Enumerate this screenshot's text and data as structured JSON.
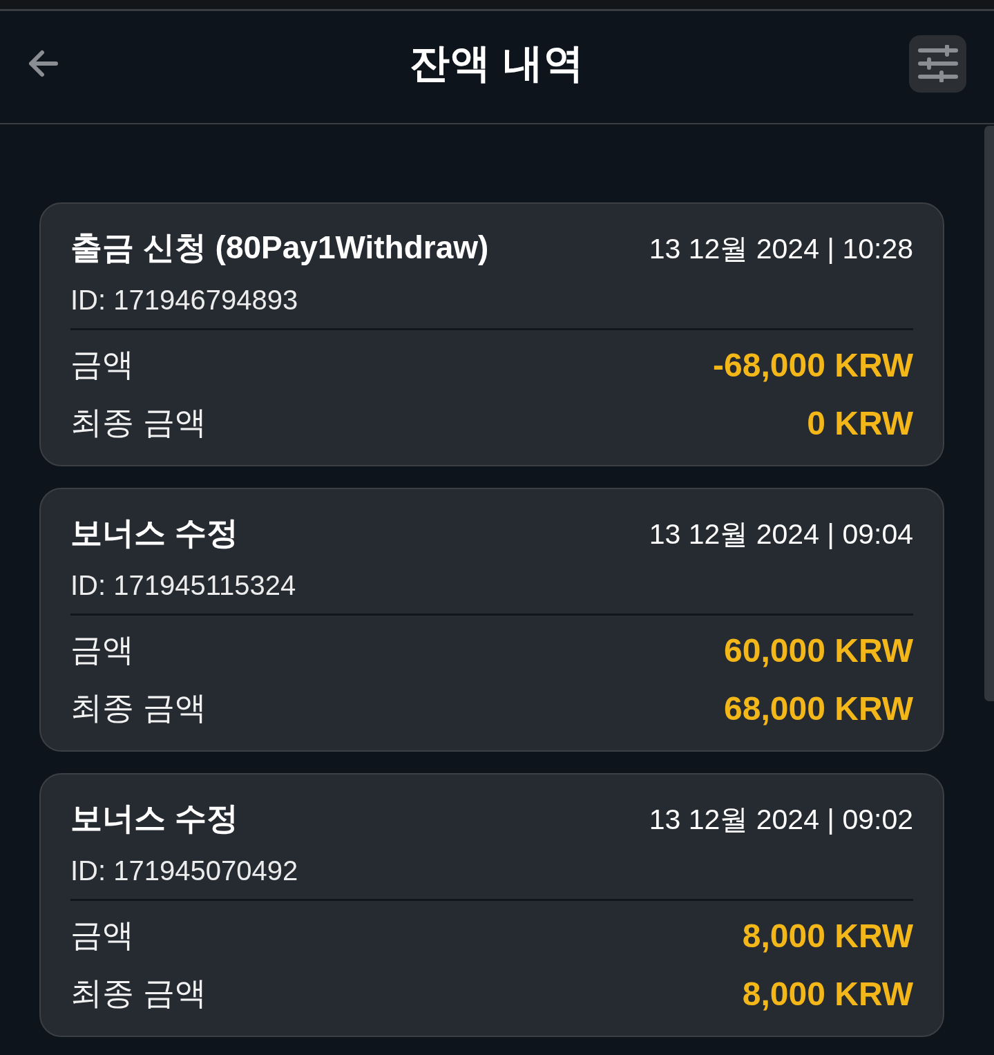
{
  "header": {
    "title": "잔액 내역"
  },
  "transactions": [
    {
      "title": "출금 신청 (80Pay1Withdraw)",
      "datetime": "13 12월 2024 | 10:28",
      "id": "ID: 171946794893",
      "rows": [
        {
          "label": "금액",
          "value": "-68,000 KRW"
        },
        {
          "label": "최종 금액",
          "value": "0 KRW"
        }
      ]
    },
    {
      "title": "보너스 수정",
      "datetime": "13 12월 2024 | 09:04",
      "id": "ID: 171945115324",
      "rows": [
        {
          "label": "금액",
          "value": "60,000 KRW"
        },
        {
          "label": "최종 금액",
          "value": "68,000 KRW"
        }
      ]
    },
    {
      "title": "보너스 수정",
      "datetime": "13 12월 2024 | 09:02",
      "id": "ID: 171945070492",
      "rows": [
        {
          "label": "금액",
          "value": "8,000 KRW"
        },
        {
          "label": "최종 금액",
          "value": "8,000 KRW"
        }
      ]
    }
  ]
}
